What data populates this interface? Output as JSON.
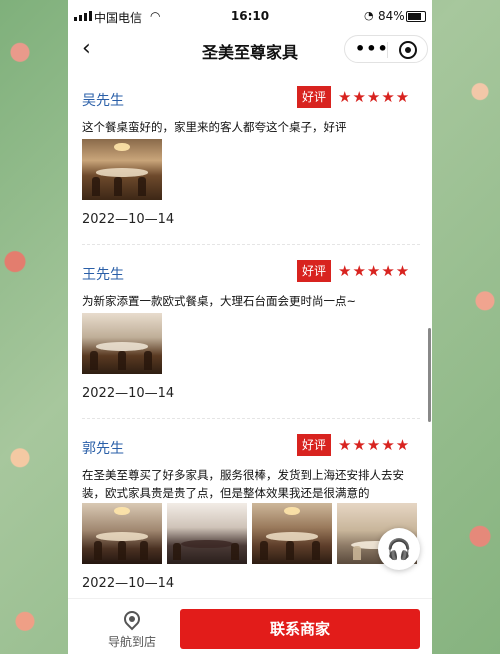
{
  "status_bar": {
    "carrier": "中国电信",
    "time": "16:10",
    "battery": "84%"
  },
  "header": {
    "title": "圣美至尊家具",
    "more_label": "•••"
  },
  "reviews": [
    {
      "name": "吴先生",
      "badge": "好评",
      "stars": "★★★★★",
      "rating": 5,
      "text": "这个餐桌蛮好的，家里来的客人都夸这个桌子，好评",
      "photo_count": 1,
      "date": "2022—10—14"
    },
    {
      "name": "王先生",
      "badge": "好评",
      "stars": "★★★★★",
      "rating": 5,
      "text": "为新家添置一款欧式餐桌，大理石台面会更时尚一点~",
      "photo_count": 1,
      "date": "2022—10—14"
    },
    {
      "name": "郭先生",
      "badge": "好评",
      "stars": "★★★★★",
      "rating": 5,
      "text": "在圣美至尊买了好多家具，服务很棒，发货到上海还安排人去安装，欧式家具贵是贵了点，但是整体效果我还是很满意的",
      "photo_count": 4,
      "date": "2022—10—14"
    }
  ],
  "bottom_bar": {
    "navigate_label": "导航到店",
    "contact_label": "联系商家"
  },
  "icons": {
    "back": "chevron-left-icon",
    "more": "more-dots-icon",
    "target": "target-icon",
    "service": "headset-icon",
    "location": "location-pin-icon"
  },
  "colors": {
    "accent": "#e21c1a",
    "name": "#2a5fa8"
  }
}
